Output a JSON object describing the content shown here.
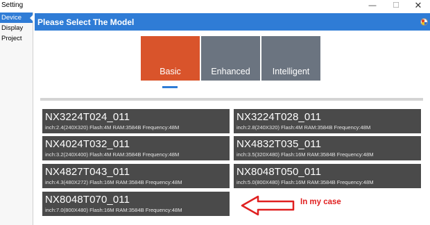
{
  "window": {
    "title": "Setting",
    "controls": {
      "minimize": "—",
      "maximize": "☐",
      "close": "✕"
    }
  },
  "sidebar": {
    "items": [
      {
        "label": "Device",
        "active": true
      },
      {
        "label": "Display",
        "active": false
      },
      {
        "label": "Project",
        "active": false
      }
    ]
  },
  "header": {
    "title": "Please Select The Model"
  },
  "tabs": [
    {
      "label": "Basic",
      "selected": true
    },
    {
      "label": "Enhanced",
      "selected": false
    },
    {
      "label": "Intelligent",
      "selected": false
    }
  ],
  "models": [
    {
      "name": "NX3224T024_011",
      "spec": "inch:2.4(240X320) Flash:4M RAM:3584B Frequency:48M"
    },
    {
      "name": "NX3224T028_011",
      "spec": "inch:2.8(240X320) Flash:4M RAM:3584B Frequency:48M"
    },
    {
      "name": "NX4024T032_011",
      "spec": "inch:3.2(240X400) Flash:4M RAM:3584B Frequency:48M"
    },
    {
      "name": "NX4832T035_011",
      "spec": "inch:3.5(320X480) Flash:16M RAM:3584B Frequency:48M"
    },
    {
      "name": "NX4827T043_011",
      "spec": "inch:4.3(480X272) Flash:16M RAM:3584B Frequency:48M"
    },
    {
      "name": "NX8048T050_011",
      "spec": "inch:5.0(800X480) Flash:16M RAM:3584B Frequency:48M"
    },
    {
      "name": "NX8048T070_011",
      "spec": "inch:7.0(800X480) Flash:16M RAM:3584B Frequency:48M"
    }
  ],
  "annotation": {
    "text": "In my case"
  },
  "colors": {
    "accent_blue": "#2f7cd6",
    "tab_selected": "#d9542b",
    "tab_unselected": "#6b7480",
    "model_tile": "#4a4a4a",
    "annotation_red": "#e02020"
  }
}
